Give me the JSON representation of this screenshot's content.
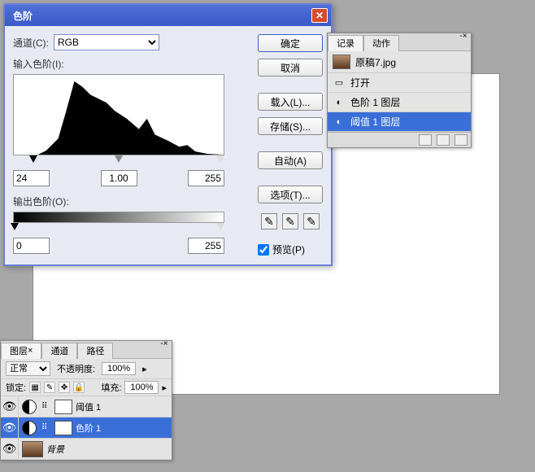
{
  "dialog": {
    "title": "色阶",
    "channel_label": "通道(C):",
    "channel_value": "RGB",
    "input_label": "输入色阶(I):",
    "output_label": "输出色阶(O):",
    "in_black": "24",
    "in_gamma": "1.00",
    "in_white": "255",
    "out_black": "0",
    "out_white": "255",
    "buttons": {
      "ok": "确定",
      "cancel": "取消",
      "load": "载入(L)...",
      "save": "存储(S)...",
      "auto": "自动(A)",
      "options": "选项(T)..."
    },
    "preview_label": "预览(P)"
  },
  "history": {
    "tab1": "记录",
    "tab2": "动作",
    "doc_name": "原稿7.jpg",
    "items": {
      "open": "打开",
      "levels": "色阶 1 图层",
      "threshold": "阈值 1 图层"
    }
  },
  "layers": {
    "tabs": {
      "layers": "图层",
      "channels": "通道",
      "paths": "路径"
    },
    "blend": "正常",
    "opacity_label": "不透明度:",
    "opacity_val": "100%",
    "lock_label": "锁定:",
    "fill_label": "填充:",
    "fill_val": "100%",
    "items": {
      "threshold": "阈值 1",
      "levels": "色阶 1",
      "bg": "背景"
    }
  }
}
